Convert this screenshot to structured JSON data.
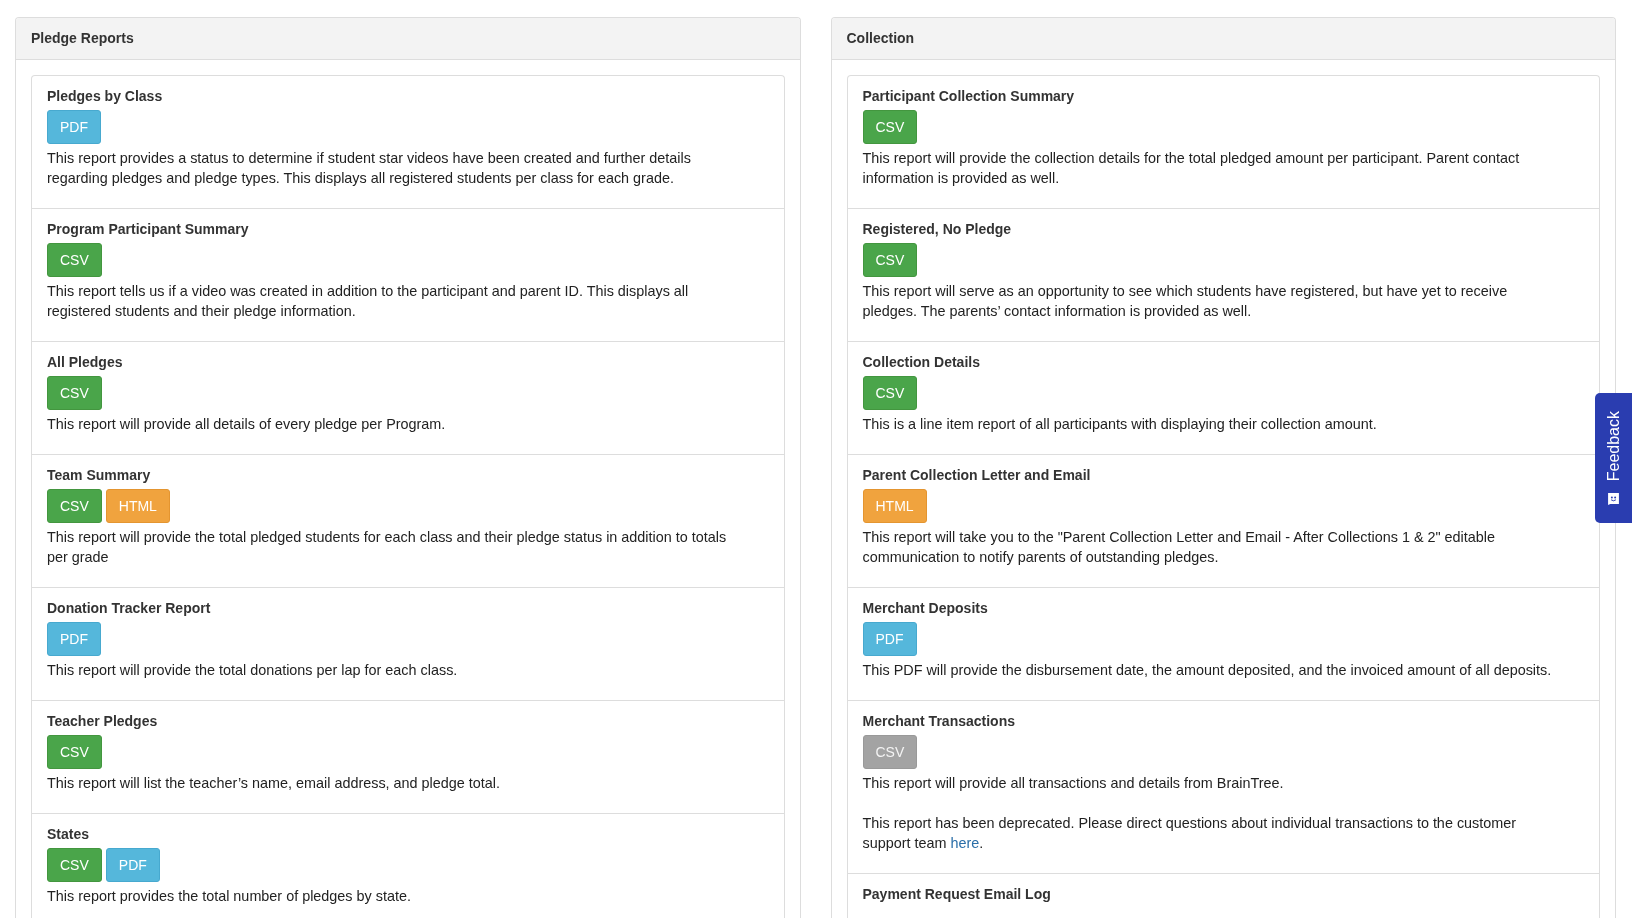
{
  "panels": [
    {
      "title": "Pledge Reports",
      "reports": [
        {
          "title": "Pledges by Class",
          "buttons": [
            {
              "label": "PDF",
              "kind": "pdf",
              "disabled": false
            }
          ],
          "paragraphs": [
            {
              "text": "This report provides a status to determine if student star videos have been created and further details regarding pledges and pledge types. This displays all registered students per class for each grade."
            }
          ]
        },
        {
          "title": "Program Participant Summary",
          "buttons": [
            {
              "label": "CSV",
              "kind": "csv",
              "disabled": false
            }
          ],
          "paragraphs": [
            {
              "text": "This report tells us if a video was created in addition to the participant and parent ID. This displays all registered students and their pledge information."
            }
          ]
        },
        {
          "title": "All Pledges",
          "buttons": [
            {
              "label": "CSV",
              "kind": "csv",
              "disabled": false
            }
          ],
          "paragraphs": [
            {
              "text": "This report will provide all details of every pledge per Program."
            }
          ]
        },
        {
          "title": "Team Summary",
          "buttons": [
            {
              "label": "CSV",
              "kind": "csv",
              "disabled": false
            },
            {
              "label": "HTML",
              "kind": "html",
              "disabled": false
            }
          ],
          "paragraphs": [
            {
              "text": "This report will provide the total pledged students for each class and their pledge status in addition to totals per grade"
            }
          ]
        },
        {
          "title": "Donation Tracker Report",
          "buttons": [
            {
              "label": "PDF",
              "kind": "pdf",
              "disabled": false
            }
          ],
          "paragraphs": [
            {
              "text": "This report will provide the total donations per lap for each class."
            }
          ]
        },
        {
          "title": "Teacher Pledges",
          "buttons": [
            {
              "label": "CSV",
              "kind": "csv",
              "disabled": false
            }
          ],
          "paragraphs": [
            {
              "text": "This report will list the teacher’s name, email address, and pledge total."
            }
          ]
        },
        {
          "title": "States",
          "buttons": [
            {
              "label": "CSV",
              "kind": "csv",
              "disabled": false
            },
            {
              "label": "PDF",
              "kind": "pdf",
              "disabled": false
            }
          ],
          "paragraphs": [
            {
              "text": "This report provides the total number of pledges by state."
            }
          ]
        }
      ]
    },
    {
      "title": "Collection",
      "reports": [
        {
          "title": "Participant Collection Summary",
          "buttons": [
            {
              "label": "CSV",
              "kind": "csv",
              "disabled": false
            }
          ],
          "paragraphs": [
            {
              "text": "This report will provide the collection details for the total pledged amount per participant. Parent contact information is provided as well."
            }
          ]
        },
        {
          "title": "Registered, No Pledge",
          "buttons": [
            {
              "label": "CSV",
              "kind": "csv",
              "disabled": false
            }
          ],
          "paragraphs": [
            {
              "text": "This report will serve as an opportunity to see which students have registered, but have yet to receive pledges. The parents’ contact information is provided as well."
            }
          ]
        },
        {
          "title": "Collection Details",
          "buttons": [
            {
              "label": "CSV",
              "kind": "csv",
              "disabled": false
            }
          ],
          "paragraphs": [
            {
              "text": "This is a line item report of all participants with displaying their collection amount."
            }
          ]
        },
        {
          "title": "Parent Collection Letter and Email",
          "buttons": [
            {
              "label": "HTML",
              "kind": "html",
              "disabled": false
            }
          ],
          "paragraphs": [
            {
              "text": "This report will take you to the \"Parent Collection Letter and Email - After Collections 1 & 2\" editable communication to notify parents of outstanding pledges."
            }
          ]
        },
        {
          "title": "Merchant Deposits",
          "buttons": [
            {
              "label": "PDF",
              "kind": "pdf",
              "disabled": false
            }
          ],
          "paragraphs": [
            {
              "text": "This PDF will provide the disbursement date, the amount deposited, and the invoiced amount of all deposits."
            }
          ]
        },
        {
          "title": "Merchant Transactions",
          "buttons": [
            {
              "label": "CSV",
              "kind": "csv",
              "disabled": true
            }
          ],
          "paragraphs": [
            {
              "text": "This report will provide all transactions and details from BrainTree."
            },
            {
              "text": "This report has been deprecated. Please direct questions about individual transactions to the customer support team ",
              "link": "here",
              "after": "."
            }
          ]
        },
        {
          "title": "Payment Request Email Log"
        }
      ]
    }
  ],
  "feedback_tab": {
    "label": "Feedback"
  }
}
